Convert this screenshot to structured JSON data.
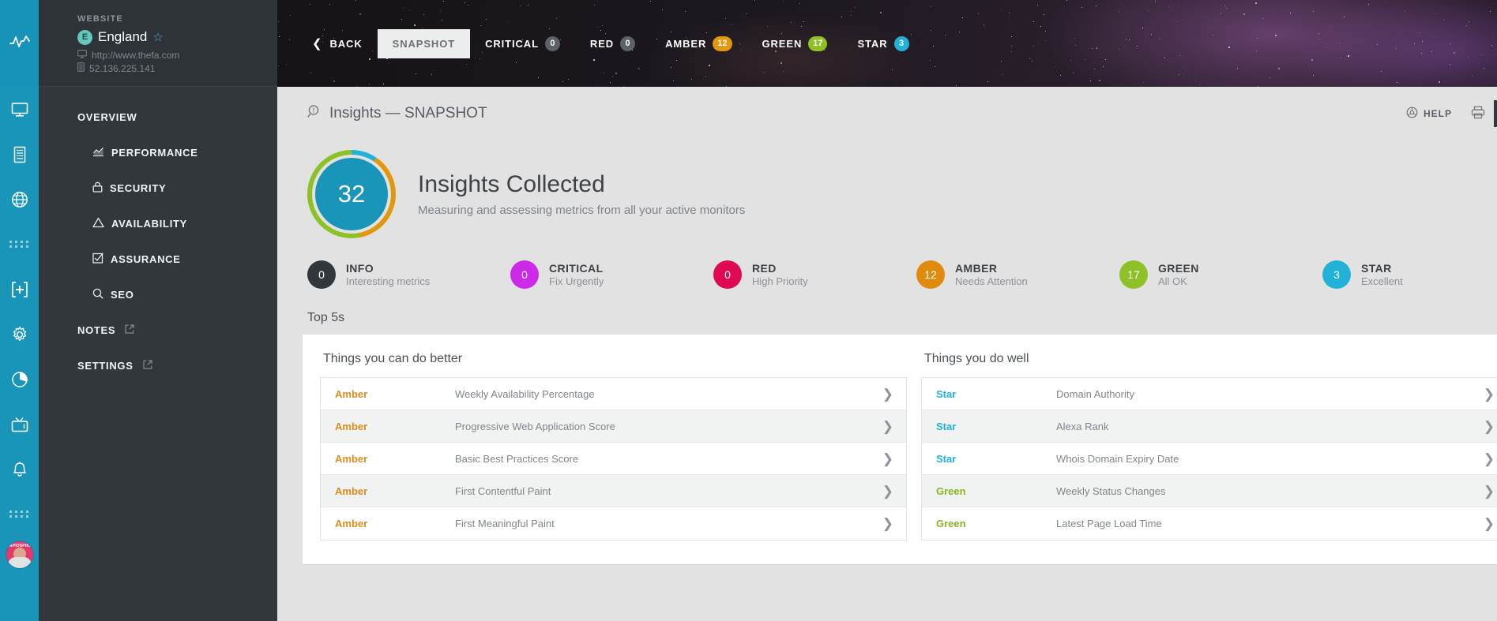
{
  "rail": {
    "icons": [
      {
        "name": "pulse-icon"
      },
      {
        "name": "monitor-icon"
      },
      {
        "name": "server-icon"
      },
      {
        "name": "globe-icon"
      },
      {
        "name": "dots-grid-icon"
      },
      {
        "name": "add-box-icon"
      },
      {
        "name": "gear-icon"
      },
      {
        "name": "pie-chart-icon"
      },
      {
        "name": "tv-icon"
      },
      {
        "name": "bell-icon"
      },
      {
        "name": "dots-grid-icon-2"
      }
    ],
    "avatar_text": "RAPIDSPIKE"
  },
  "sidebar": {
    "section_label": "WEBSITE",
    "site_initial": "E",
    "site_name": "England",
    "site_url": "http://www.thefa.com",
    "site_ip": "52.136.225.141",
    "nav": [
      {
        "label": "OVERVIEW",
        "icon": "",
        "external": false
      },
      {
        "label": "PERFORMANCE",
        "icon": "chart-line-icon",
        "external": false
      },
      {
        "label": "SECURITY",
        "icon": "lock-icon",
        "external": false
      },
      {
        "label": "AVAILABILITY",
        "icon": "warning-triangle-icon",
        "external": false
      },
      {
        "label": "ASSURANCE",
        "icon": "check-square-icon",
        "external": false
      },
      {
        "label": "SEO",
        "icon": "search-icon",
        "external": false
      },
      {
        "label": "NOTES",
        "icon": "",
        "external": true
      },
      {
        "label": "SETTINGS",
        "icon": "",
        "external": true
      }
    ]
  },
  "topbar": {
    "back_label": "BACK",
    "tabs": [
      {
        "label": "SNAPSHOT",
        "count": null,
        "active": true,
        "pill": null
      },
      {
        "label": "CRITICAL",
        "count": "0",
        "active": false,
        "pill": "grey"
      },
      {
        "label": "RED",
        "count": "0",
        "active": false,
        "pill": "grey"
      },
      {
        "label": "AMBER",
        "count": "12",
        "active": false,
        "pill": "amber"
      },
      {
        "label": "GREEN",
        "count": "17",
        "active": false,
        "pill": "green"
      },
      {
        "label": "STAR",
        "count": "3",
        "active": false,
        "pill": "star"
      }
    ]
  },
  "header": {
    "title": "Insights — SNAPSHOT",
    "help_label": "HELP",
    "print_icon": "printer-icon",
    "refresh_icon": "refresh-icon"
  },
  "summary": {
    "count": "32",
    "title": "Insights Collected",
    "subtitle": "Measuring and assessing metrics from all your active monitors"
  },
  "stats": [
    {
      "count": "0",
      "name": "INFO",
      "desc": "Interesting metrics",
      "color": "#32373c"
    },
    {
      "count": "0",
      "name": "CRITICAL",
      "desc": "Fix Urgently",
      "color": "#cc2ae8"
    },
    {
      "count": "0",
      "name": "RED",
      "desc": "High Priority",
      "color": "#e00a54"
    },
    {
      "count": "12",
      "name": "AMBER",
      "desc": "Needs Attention",
      "color": "#e08b0d"
    },
    {
      "count": "17",
      "name": "GREEN",
      "desc": "All OK",
      "color": "#8ec127"
    },
    {
      "count": "3",
      "name": "STAR",
      "desc": "Excellent",
      "color": "#22b2d8"
    }
  ],
  "top5": {
    "label": "Top 5s",
    "left": {
      "title": "Things you can do better",
      "rows": [
        {
          "tag": "Amber",
          "tag_class": "amber",
          "name": "Weekly Availability Percentage"
        },
        {
          "tag": "Amber",
          "tag_class": "amber",
          "name": "Progressive Web Application Score"
        },
        {
          "tag": "Amber",
          "tag_class": "amber",
          "name": "Basic Best Practices Score"
        },
        {
          "tag": "Amber",
          "tag_class": "amber",
          "name": "First Contentful Paint"
        },
        {
          "tag": "Amber",
          "tag_class": "amber",
          "name": "First Meaningful Paint"
        }
      ]
    },
    "right": {
      "title": "Things you do well",
      "rows": [
        {
          "tag": "Star",
          "tag_class": "star",
          "name": "Domain Authority"
        },
        {
          "tag": "Star",
          "tag_class": "star",
          "name": "Alexa Rank"
        },
        {
          "tag": "Star",
          "tag_class": "star",
          "name": "Whois Domain Expiry Date"
        },
        {
          "tag": "Green",
          "tag_class": "green",
          "name": "Weekly Status Changes"
        },
        {
          "tag": "Green",
          "tag_class": "green",
          "name": "Latest Page Load Time"
        }
      ]
    }
  },
  "colors": {
    "rail": "#1a95ba",
    "sidebar": "#32373c",
    "accent": "#22b2d8",
    "amber": "#e08b0d",
    "green": "#8ec127",
    "red": "#e00a54",
    "critical": "#cc2ae8"
  }
}
